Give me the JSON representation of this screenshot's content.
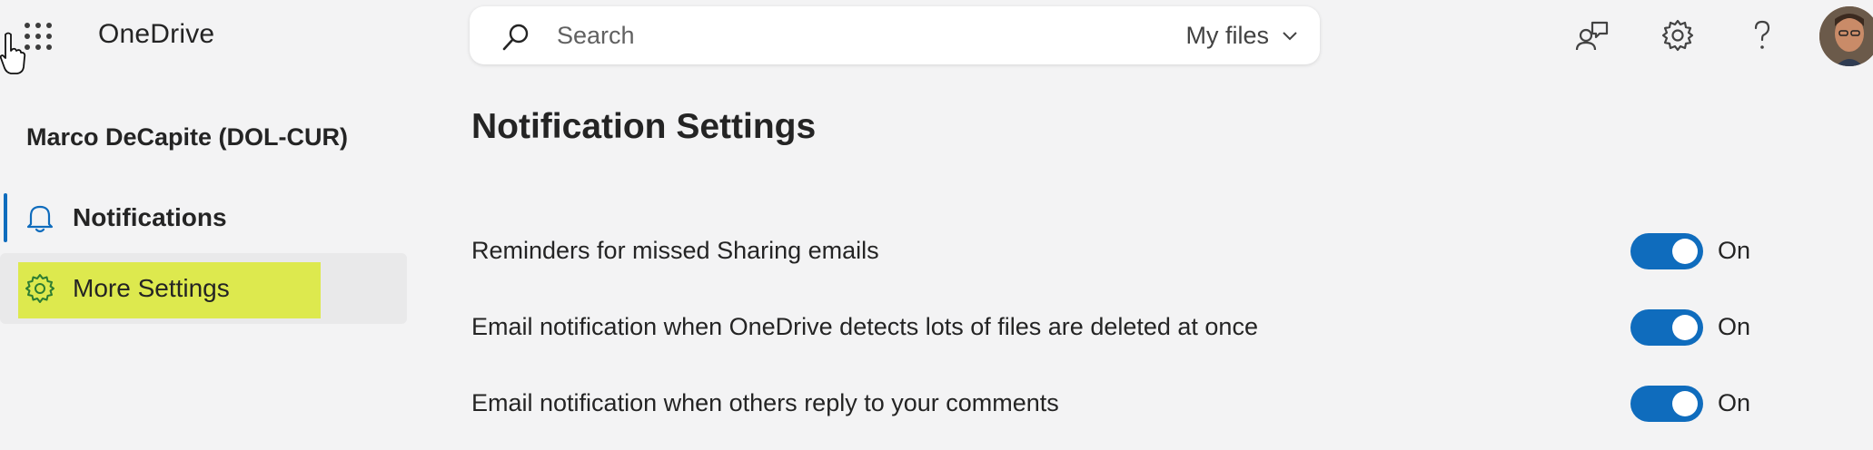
{
  "app": {
    "title": "OneDrive"
  },
  "search": {
    "placeholder": "Search",
    "scope": "My files"
  },
  "header_icons": [
    "feedback-icon",
    "gear-icon",
    "help-icon",
    "avatar"
  ],
  "sidebar": {
    "user_name": "Marco DeCapite (DOL-CUR)",
    "items": [
      {
        "label": "Notifications",
        "icon": "bell-icon",
        "selected": true
      },
      {
        "label": "More Settings",
        "icon": "gear-icon",
        "highlighted": true
      }
    ]
  },
  "main": {
    "title": "Notification Settings",
    "settings": [
      {
        "label": "Reminders for missed Sharing emails",
        "state": "On"
      },
      {
        "label": "Email notification when OneDrive detects lots of files are deleted at once",
        "state": "On"
      },
      {
        "label": "Email notification when others reply to your comments",
        "state": "On"
      }
    ]
  },
  "colors": {
    "accent": "#0f6cbd",
    "highlight": "#dde94e",
    "background": "#f3f3f4"
  }
}
